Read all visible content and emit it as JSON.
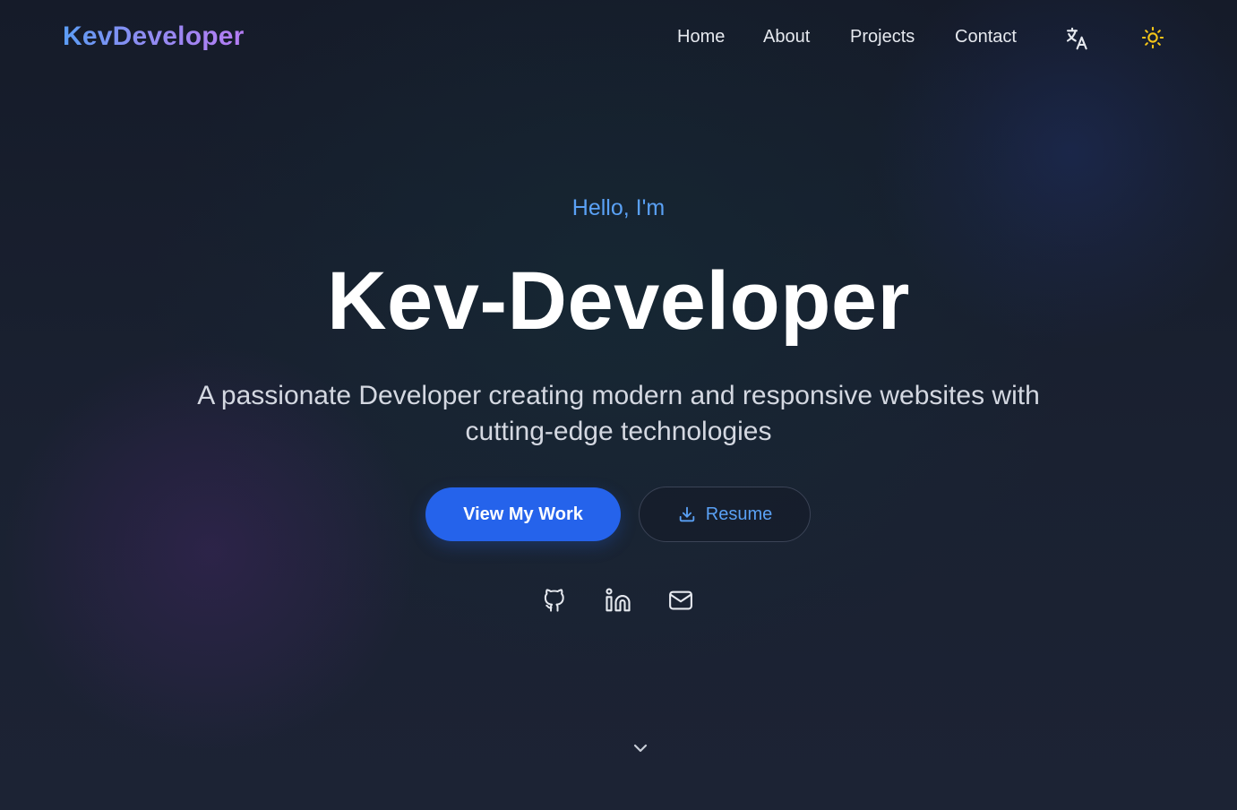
{
  "nav": {
    "logo_part1": "Kev",
    "logo_part2": "Developer",
    "links": [
      {
        "label": "Home"
      },
      {
        "label": "About"
      },
      {
        "label": "Projects"
      },
      {
        "label": "Contact"
      }
    ],
    "language_icon": "translate-icon",
    "theme_icon": "sun-icon"
  },
  "hero": {
    "greeting": "Hello, I'm",
    "name": "Kev-Developer",
    "tagline": "A passionate Developer creating modern and responsive websites with cutting-edge technologies",
    "primary_button": "View My Work",
    "secondary_button": "Resume",
    "secondary_button_icon": "download-icon",
    "social_icons": [
      "github-icon",
      "linkedin-icon",
      "mail-icon"
    ],
    "scroll_icon": "chevron-down-icon"
  },
  "colors": {
    "background": "#1a2030",
    "accent": "#2563eb",
    "accent_text": "#5aa1f5",
    "sun": "#f5c518",
    "logo_gradient_start": "#5b9df5",
    "logo_gradient_end": "#b57cf3"
  }
}
